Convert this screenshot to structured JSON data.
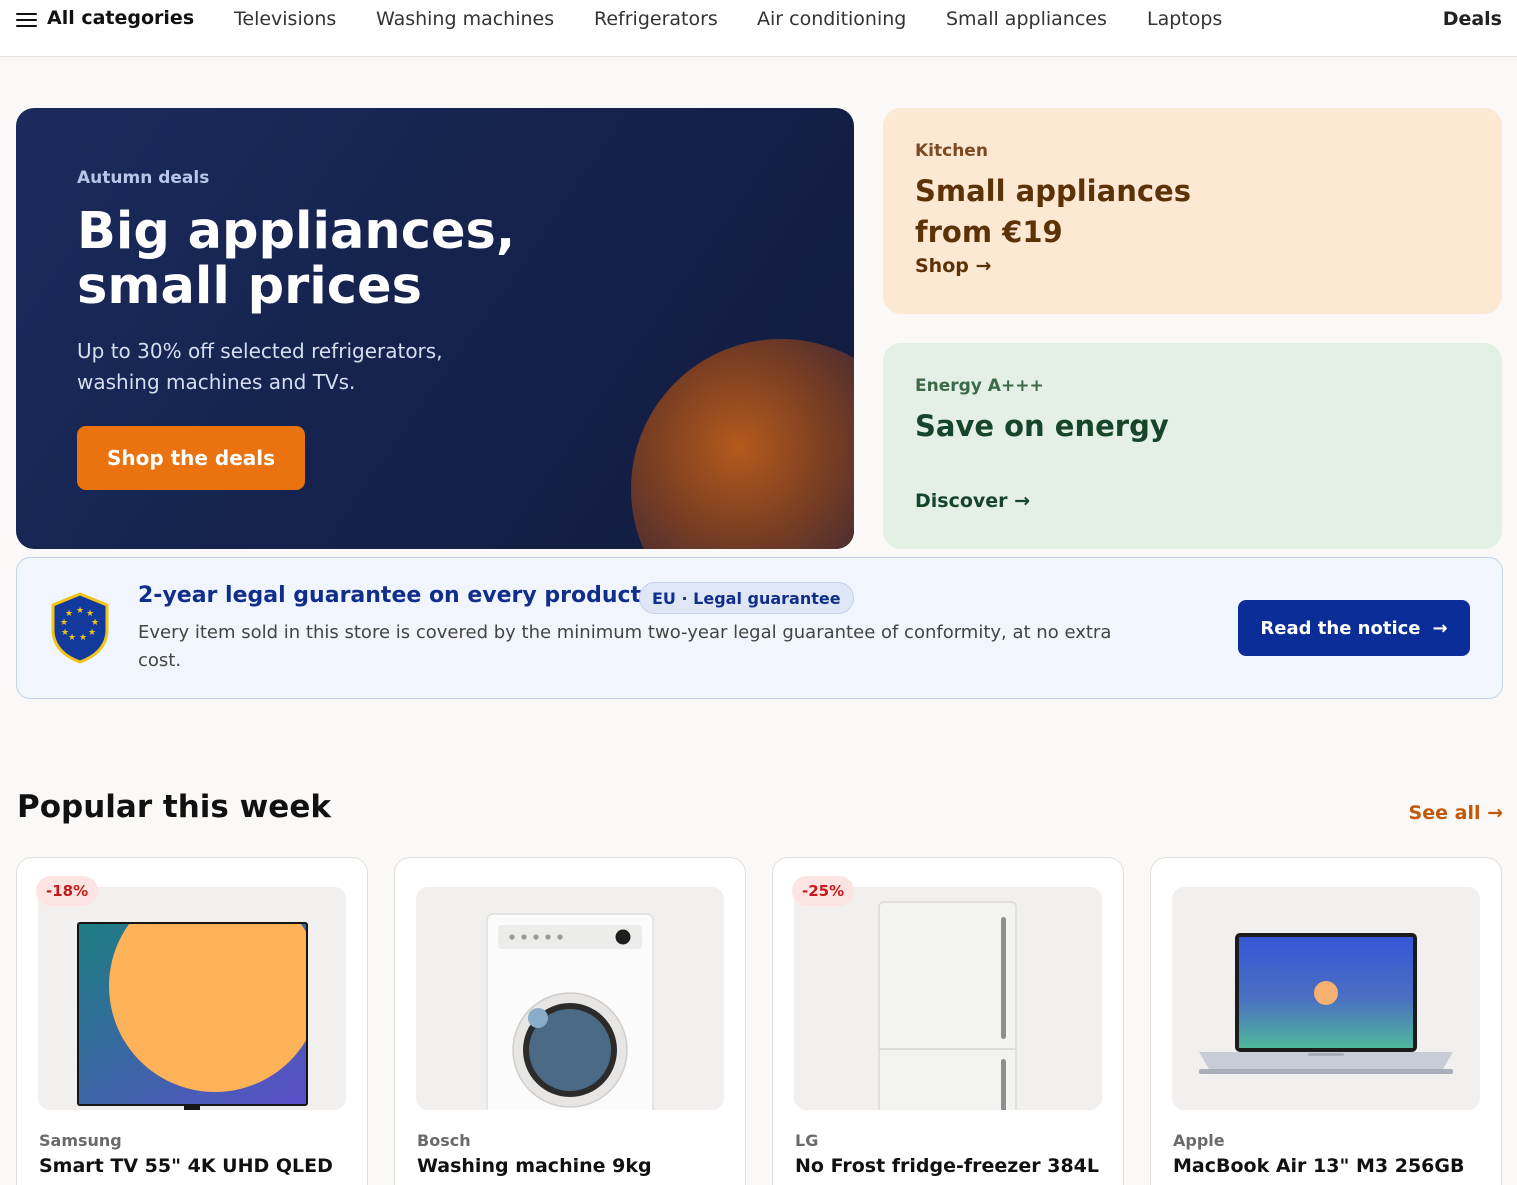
{
  "nav": {
    "all_categories": "All categories",
    "links": [
      "Televisions",
      "Washing machines",
      "Refrigerators",
      "Air conditioning",
      "Small appliances",
      "Laptops"
    ],
    "deals": "Deals"
  },
  "hero": {
    "eyebrow": "Autumn deals",
    "title": "Big appliances, small prices",
    "subtitle": "Up to 30% off selected refrigerators, washing machines and TVs.",
    "cta": "Shop the deals"
  },
  "promos": [
    {
      "eyebrow": "Kitchen",
      "title": "Small appliances from €19",
      "link": "Shop →",
      "bg": "#fde8d4"
    },
    {
      "eyebrow": "Energy A+++",
      "title": "Save on energy",
      "link": "Discover →",
      "bg": "#e4efe5"
    }
  ],
  "guarantee": {
    "title": "2-year legal guarantee on every product",
    "badge": "EU · Legal guarantee",
    "text": "Every item sold in this store is covered by the minimum two-year legal guarantee of conformity, at no extra cost.",
    "button": "Read the notice",
    "button_icon": "→"
  },
  "popular": {
    "title": "Popular this week",
    "see_all": "See all →",
    "products": [
      {
        "brand": "Samsung",
        "name": "Smart TV 55\" 4K UHD QLED",
        "discount": "-18%",
        "icon": "tv-icon"
      },
      {
        "brand": "Bosch",
        "name": "Washing machine 9kg",
        "discount": "",
        "icon": "washing-machine-icon"
      },
      {
        "brand": "LG",
        "name": "No Frost fridge-freezer 384L",
        "discount": "-25%",
        "icon": "fridge-icon"
      },
      {
        "brand": "Apple",
        "name": "MacBook Air 13\" M3 256GB",
        "discount": "",
        "icon": "laptop-icon"
      }
    ]
  },
  "colors": {
    "accent": "#ea720f",
    "hero_bg": "#1a2b5c",
    "guarantee_button": "#0a2d97",
    "discount_text": "#c11b1b"
  }
}
